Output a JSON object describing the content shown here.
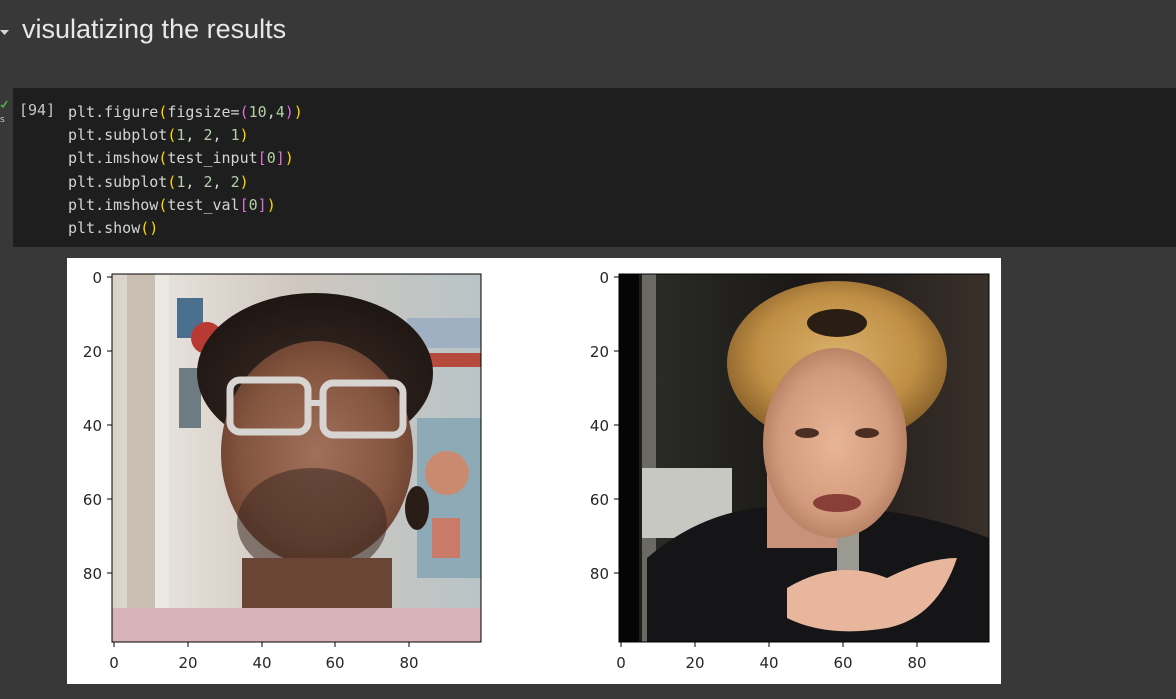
{
  "section": {
    "title": "visulatizing the results"
  },
  "cell": {
    "execution_count": "[94]",
    "lines": [
      [
        {
          "t": "plt.figure",
          "c": "call"
        },
        {
          "t": "(",
          "c": "p1"
        },
        {
          "t": "figsize=",
          "c": "call"
        },
        {
          "t": "(",
          "c": "p2"
        },
        {
          "t": "10",
          "c": "num"
        },
        {
          "t": ",",
          "c": "call"
        },
        {
          "t": "4",
          "c": "num"
        },
        {
          "t": ")",
          "c": "p2"
        },
        {
          "t": ")",
          "c": "p1"
        }
      ],
      [
        {
          "t": "plt.subplot",
          "c": "call"
        },
        {
          "t": "(",
          "c": "p1"
        },
        {
          "t": "1",
          "c": "num"
        },
        {
          "t": ", ",
          "c": "call"
        },
        {
          "t": "2",
          "c": "num"
        },
        {
          "t": ", ",
          "c": "call"
        },
        {
          "t": "1",
          "c": "num"
        },
        {
          "t": ")",
          "c": "p1"
        }
      ],
      [
        {
          "t": "plt.imshow",
          "c": "call"
        },
        {
          "t": "(",
          "c": "p1"
        },
        {
          "t": "test_input",
          "c": "call"
        },
        {
          "t": "[",
          "c": "p2"
        },
        {
          "t": "0",
          "c": "num"
        },
        {
          "t": "]",
          "c": "p2"
        },
        {
          "t": ")",
          "c": "p1"
        }
      ],
      [
        {
          "t": "plt.subplot",
          "c": "call"
        },
        {
          "t": "(",
          "c": "p1"
        },
        {
          "t": "1",
          "c": "num"
        },
        {
          "t": ", ",
          "c": "call"
        },
        {
          "t": "2",
          "c": "num"
        },
        {
          "t": ", ",
          "c": "call"
        },
        {
          "t": "2",
          "c": "num"
        },
        {
          "t": ")",
          "c": "p1"
        }
      ],
      [
        {
          "t": "plt.imshow",
          "c": "call"
        },
        {
          "t": "(",
          "c": "p1"
        },
        {
          "t": "test_val",
          "c": "call"
        },
        {
          "t": "[",
          "c": "p2"
        },
        {
          "t": "0",
          "c": "num"
        },
        {
          "t": "]",
          "c": "p2"
        },
        {
          "t": ")",
          "c": "p1"
        }
      ],
      [
        {
          "t": "plt.show",
          "c": "call"
        },
        {
          "t": "()",
          "c": "p1"
        }
      ]
    ]
  },
  "output": {
    "subplots": [
      {
        "image_description": "pixelated photo of a young man with curly hair and glasses",
        "y_ticks": [
          "0",
          "20",
          "40",
          "60",
          "80"
        ],
        "x_ticks": [
          "0",
          "20",
          "40",
          "60",
          "80"
        ]
      },
      {
        "image_description": "pixelated photo of a woman with short blonde hair in a dark jacket",
        "y_ticks": [
          "0",
          "20",
          "40",
          "60",
          "80"
        ],
        "x_ticks": [
          "0",
          "20",
          "40",
          "60",
          "80"
        ]
      }
    ]
  },
  "colors": {
    "page_bg": "#383838",
    "code_bg": "#1e1e1e",
    "run_check": "#4caf50"
  },
  "icons": {
    "collapse": "triangle-down-icon",
    "status": "check-icon"
  }
}
